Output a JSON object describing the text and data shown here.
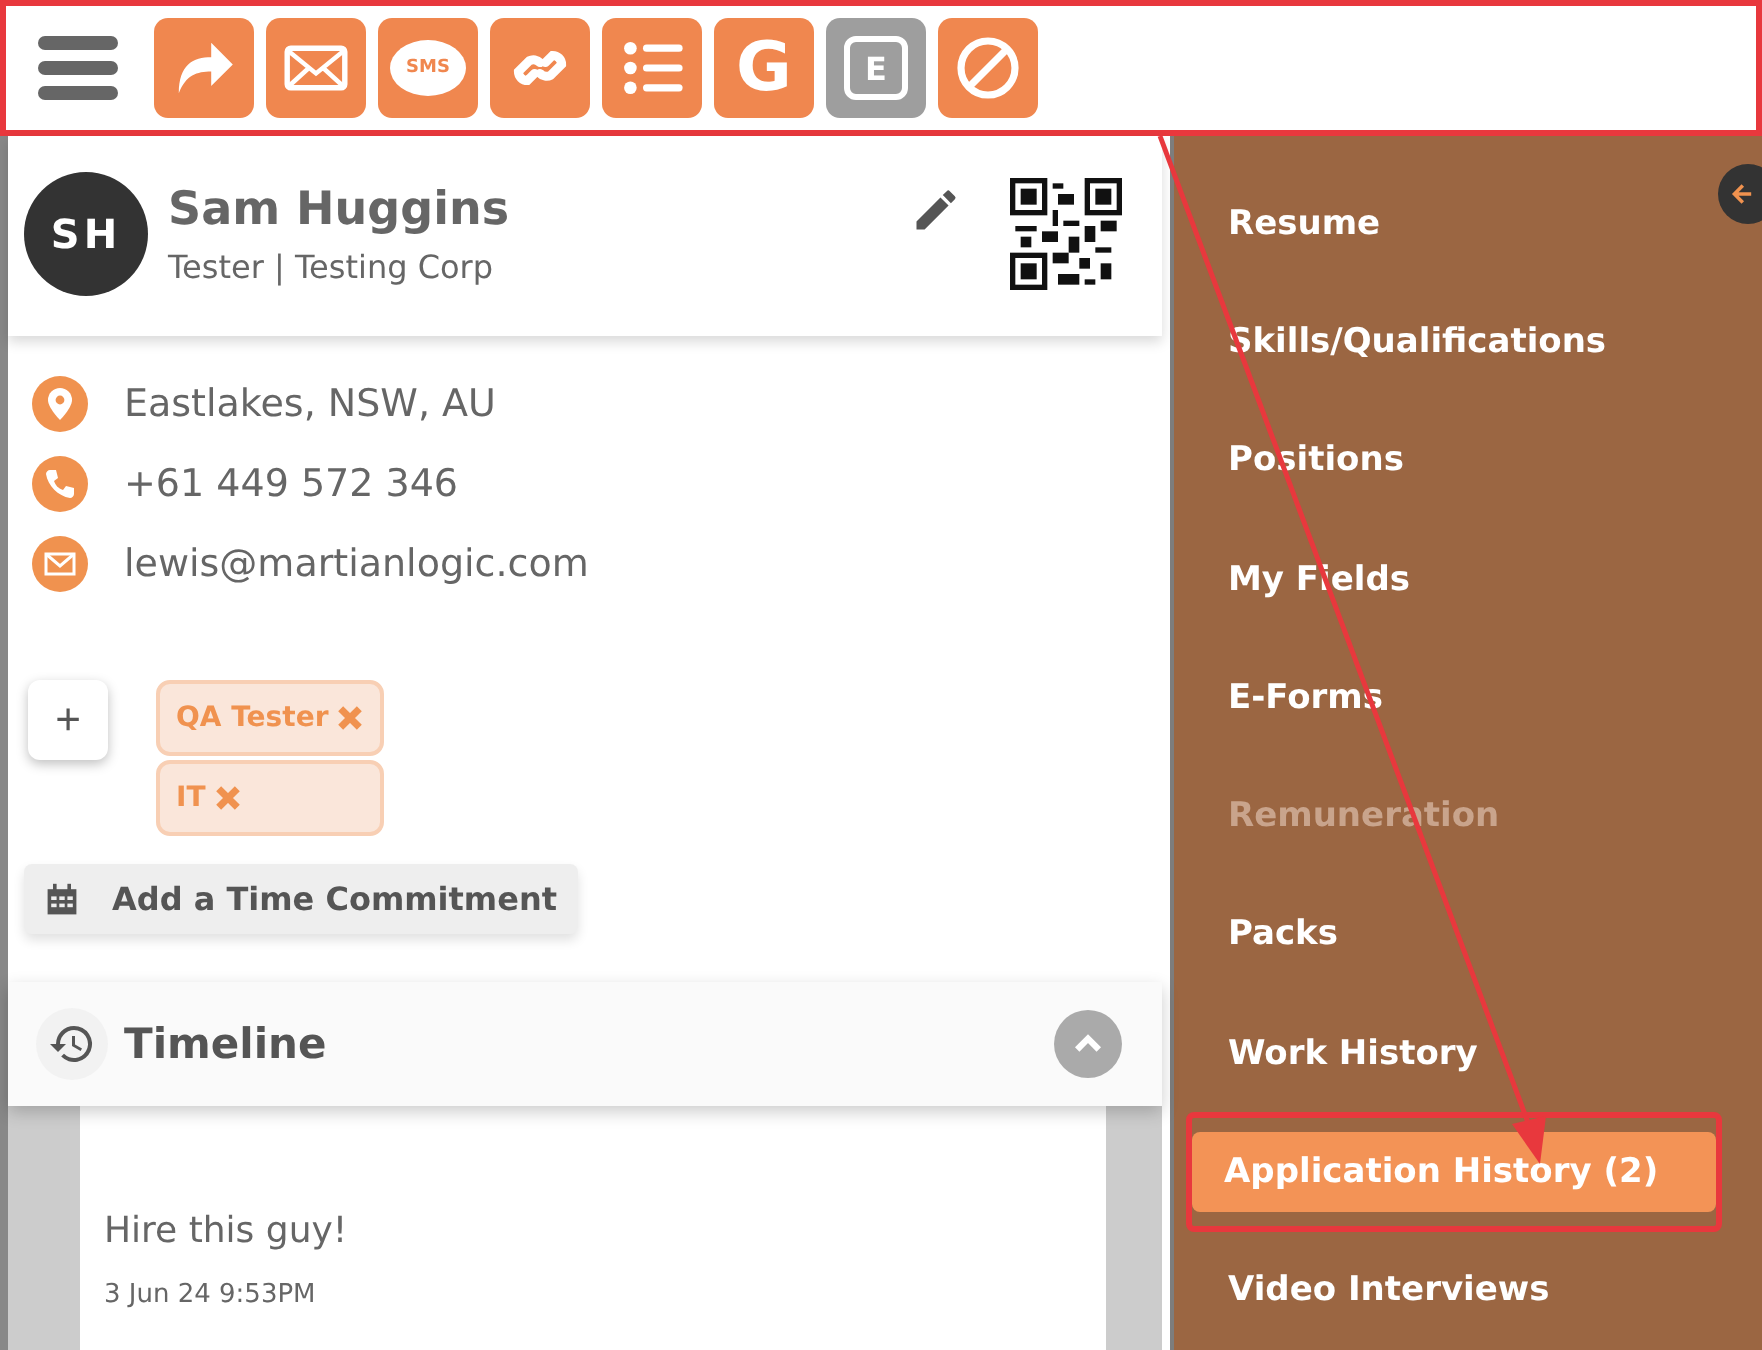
{
  "toolbar": {
    "highlighted": true,
    "buttons": [
      {
        "kind": "share",
        "disabled": false
      },
      {
        "kind": "email",
        "disabled": false
      },
      {
        "kind": "sms",
        "label": "SMS",
        "disabled": false
      },
      {
        "kind": "link",
        "disabled": false
      },
      {
        "kind": "list",
        "disabled": false
      },
      {
        "kind": "google",
        "label": "G",
        "disabled": false
      },
      {
        "kind": "eform",
        "label": "E",
        "disabled": true
      },
      {
        "kind": "block",
        "disabled": false
      }
    ]
  },
  "profile": {
    "initials": "SH",
    "name": "Sam Huggins",
    "subtitle": "Tester | Testing Corp"
  },
  "contacts": [
    {
      "kind": "location",
      "text": "Eastlakes, NSW, AU"
    },
    {
      "kind": "phone",
      "text": "+61 449 572 346"
    },
    {
      "kind": "email",
      "text": "lewis@martianlogic.com"
    }
  ],
  "add_tag_button": "+",
  "tags": [
    "QA Tester",
    "IT"
  ],
  "time_commitment_button": "Add a Time Commitment",
  "timeline": {
    "title": "Timeline",
    "expanded": true,
    "comment": {
      "text": "Hire this guy!",
      "date": "3 Jun 24 9:53PM"
    }
  },
  "sidebar": {
    "items": [
      {
        "label": "Resume",
        "selected": false,
        "disabled": false,
        "highlighted": false
      },
      {
        "label": "Skills/Qualifications",
        "selected": false,
        "disabled": false,
        "highlighted": false
      },
      {
        "label": "Positions",
        "selected": false,
        "disabled": false,
        "highlighted": false
      },
      {
        "label": "My Fields",
        "selected": false,
        "disabled": false,
        "highlighted": false
      },
      {
        "label": "E-Forms",
        "selected": false,
        "disabled": false,
        "highlighted": false
      },
      {
        "label": "Remuneration",
        "selected": false,
        "disabled": true,
        "highlighted": false
      },
      {
        "label": "Packs",
        "selected": false,
        "disabled": false,
        "highlighted": false
      },
      {
        "label": "Work History",
        "selected": false,
        "disabled": false,
        "highlighted": false
      },
      {
        "label": "Application History (2)",
        "selected": true,
        "disabled": false,
        "highlighted": true
      },
      {
        "label": "Video Interviews",
        "selected": false,
        "disabled": false,
        "highlighted": false
      }
    ]
  }
}
